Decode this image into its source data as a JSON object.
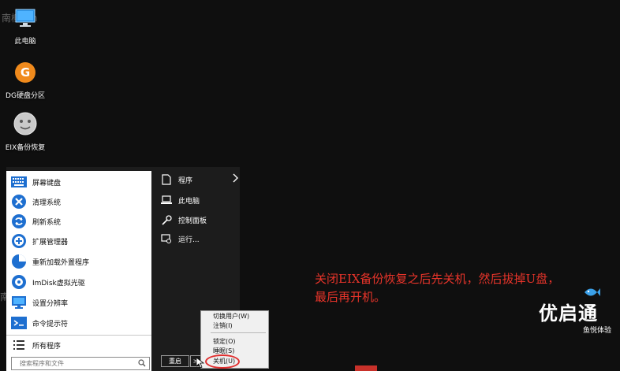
{
  "watermarks": {
    "top_left": "南柳Min",
    "left": "南"
  },
  "desktop": {
    "icons": [
      {
        "label": "此电脑",
        "icon": "computer-icon"
      },
      {
        "label": "DG硬盘分区",
        "icon": "disk-genius-icon"
      },
      {
        "label": "EIX备份恢复",
        "icon": "backup-face-icon"
      }
    ]
  },
  "start_menu": {
    "left_items": [
      {
        "label": "屏幕键盘",
        "icon": "keyboard-icon"
      },
      {
        "label": "清理系统",
        "icon": "clean-x-icon"
      },
      {
        "label": "刷新系统",
        "icon": "refresh-icon"
      },
      {
        "label": "扩展管理器",
        "icon": "plus-circle-icon"
      },
      {
        "label": "重新加载外置程序",
        "icon": "pie-chart-icon"
      },
      {
        "label": "ImDisk虚拟光驱",
        "icon": "disc-icon"
      },
      {
        "label": "设置分辨率",
        "icon": "monitor-icon"
      },
      {
        "label": "命令提示符",
        "icon": "cmd-icon"
      }
    ],
    "all_programs": "所有程序",
    "search_placeholder": "搜索程序和文件",
    "right_items": [
      {
        "label": "程序",
        "icon": "page-icon",
        "has_arrow": true
      },
      {
        "label": "此电脑",
        "icon": "laptop-icon"
      },
      {
        "label": "控制面板",
        "icon": "wrench-icon"
      },
      {
        "label": "运行...",
        "icon": "run-icon"
      }
    ],
    "restart_label": "重启",
    "arrow_label": ">"
  },
  "power_menu": {
    "items": [
      "切换用户(W)",
      "注销(I)",
      "锁定(O)",
      "睡眠(S)",
      "关机(U)"
    ]
  },
  "annotation": {
    "line1": "关闭EIX备份恢复之后先关机，然后拔掉U盘，",
    "line2": "最后再开机。"
  },
  "brand": {
    "name": "优启通",
    "tagline": "鱼悦体验"
  },
  "colors": {
    "desktop_bg": "#0f0f0f",
    "start_menu_bg": "#1c1c1c",
    "annotation": "#e8342a",
    "highlight_circle": "#e03030",
    "icon_blue": "#1e6fd0"
  }
}
